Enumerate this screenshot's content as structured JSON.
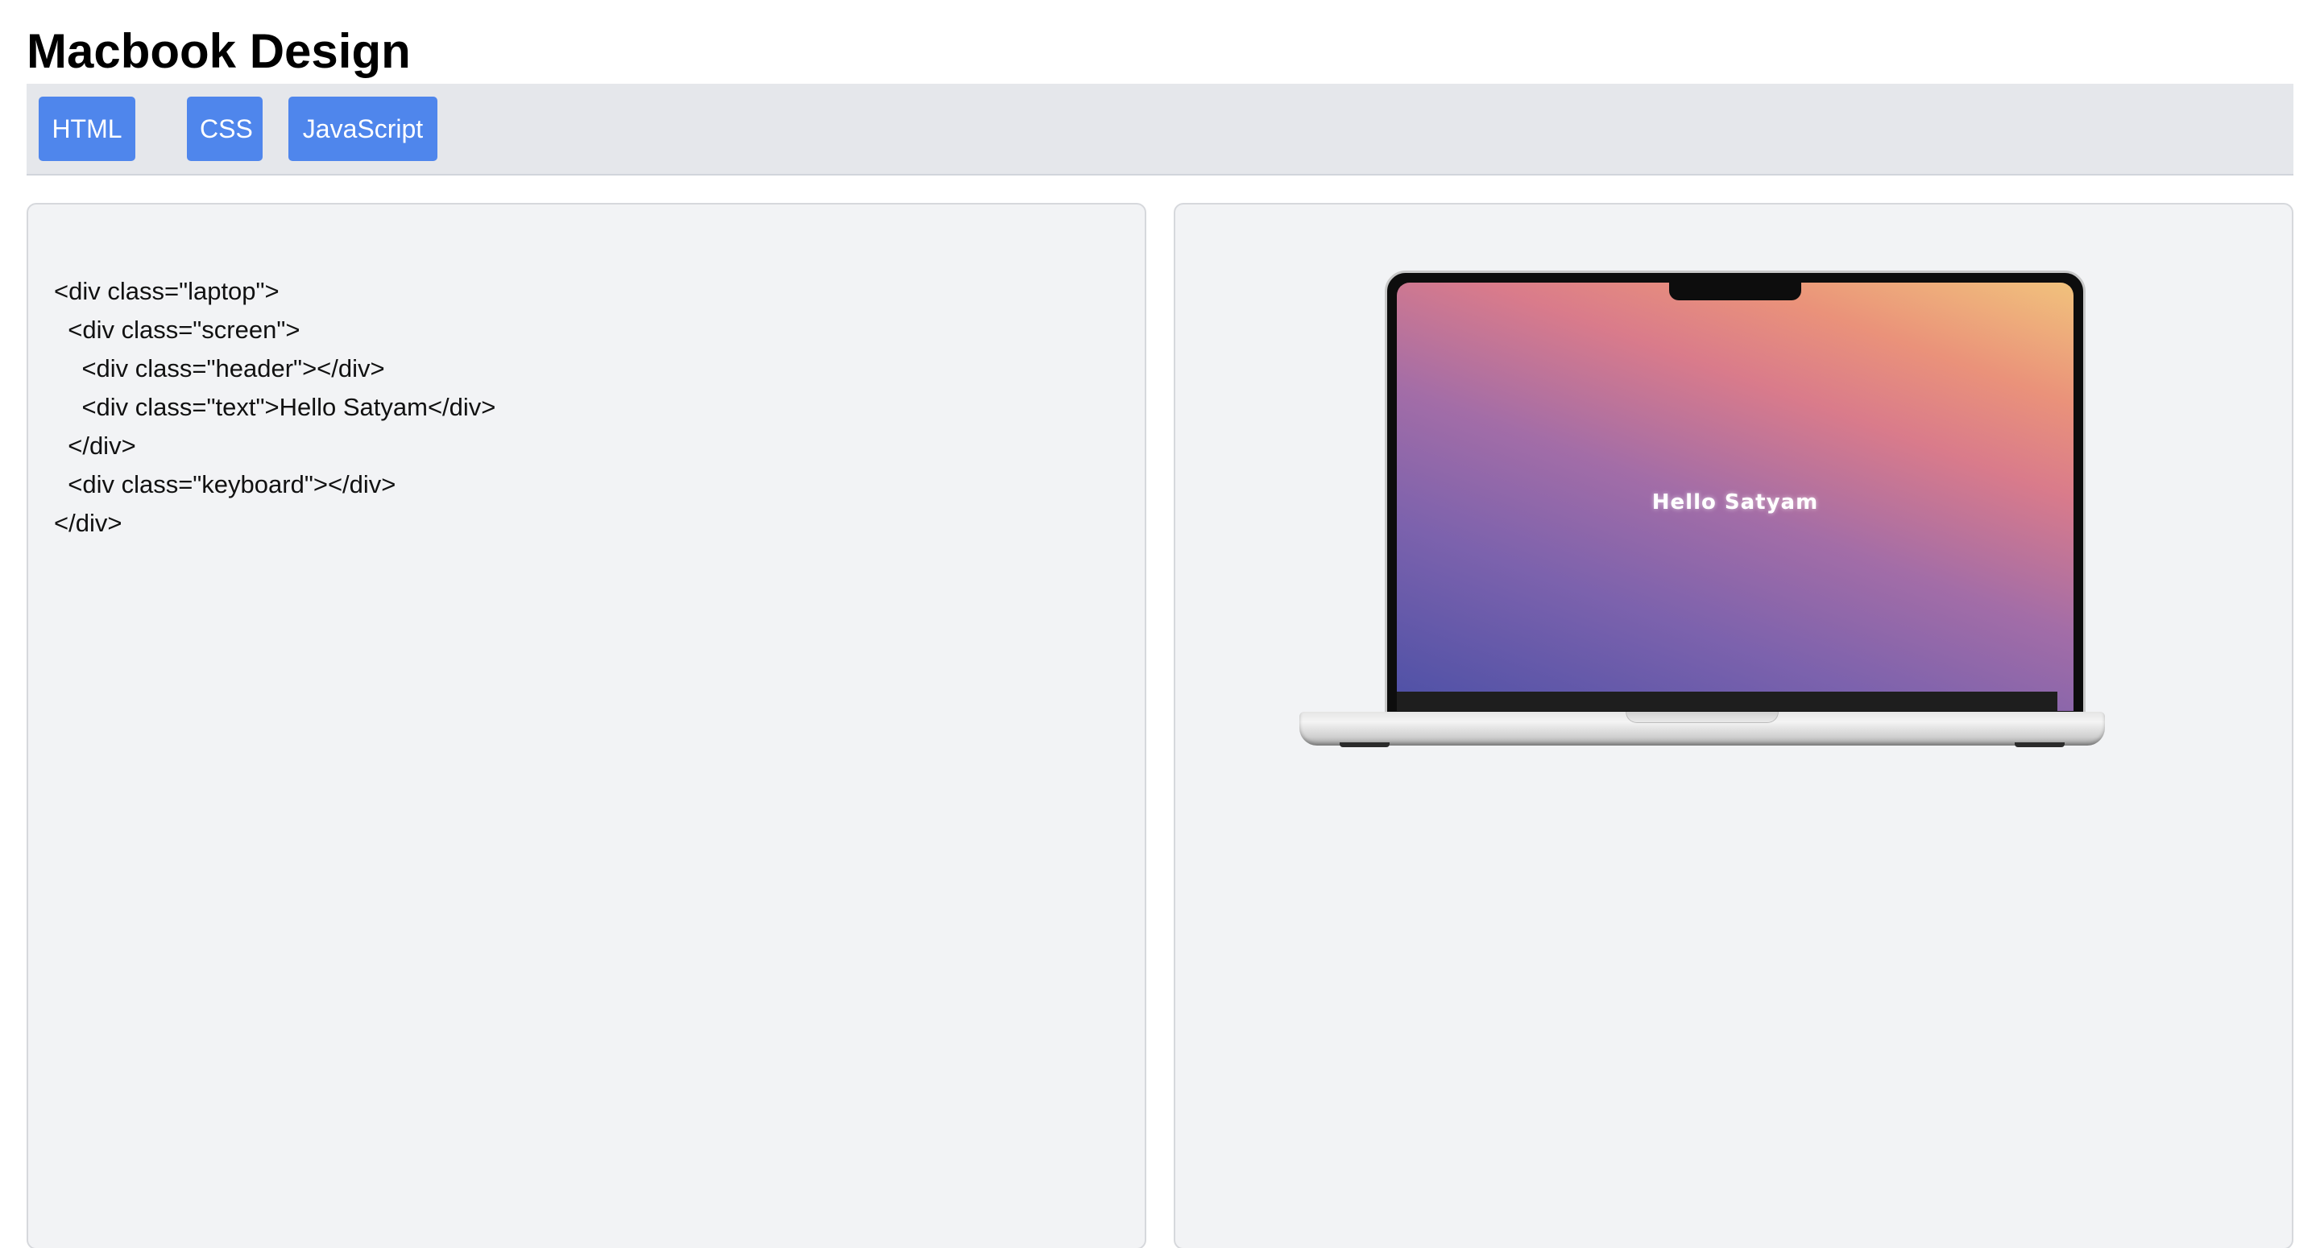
{
  "page": {
    "title": "Macbook Design"
  },
  "tabs": [
    {
      "label": "HTML"
    },
    {
      "label": "CSS"
    },
    {
      "label": "JavaScript"
    }
  ],
  "colors": {
    "tab_background": "#4f86ec",
    "tabbar_background": "#e5e7eb",
    "panel_background": "#f2f3f5"
  },
  "code_panel": {
    "lines": [
      "<div class=\"laptop\">",
      "  <div class=\"screen\">",
      "    <div class=\"header\"></div>",
      "    <div class=\"text\">Hello Satyam</div>",
      "  </div>",
      "  <div class=\"keyboard\"></div>",
      "</div>"
    ]
  },
  "preview_panel": {
    "screen_text": "Hello Satyam"
  }
}
